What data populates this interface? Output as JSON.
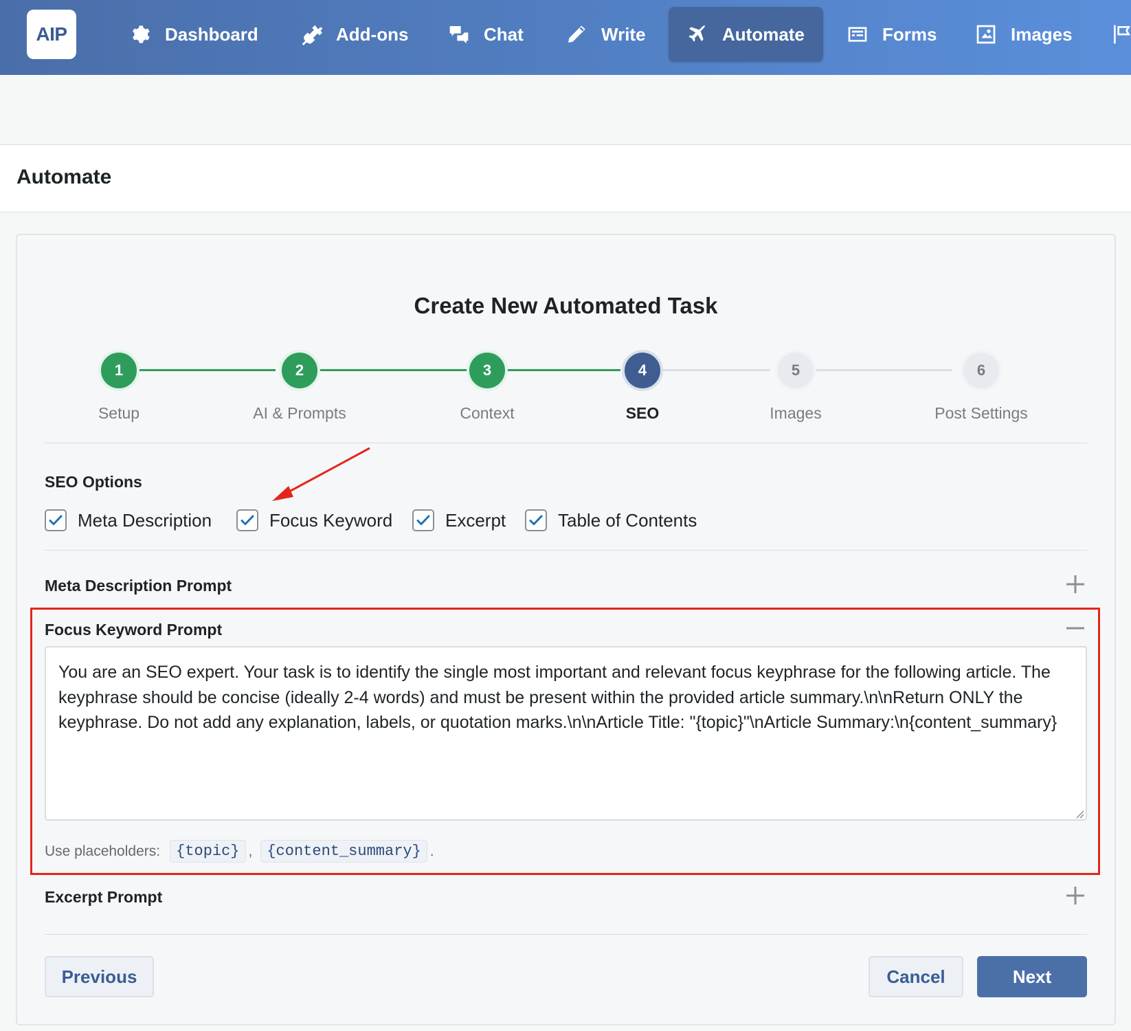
{
  "nav": {
    "logo": "AIP",
    "items": [
      {
        "label": "Dashboard"
      },
      {
        "label": "Add-ons"
      },
      {
        "label": "Chat"
      },
      {
        "label": "Write"
      },
      {
        "label": "Automate"
      },
      {
        "label": "Forms"
      },
      {
        "label": "Images"
      }
    ],
    "active_item": "Automate"
  },
  "page": {
    "title": "Automate"
  },
  "wizard": {
    "title": "Create New Automated Task",
    "current_step": 4,
    "steps": [
      {
        "number": "1",
        "label": "Setup",
        "state": "done"
      },
      {
        "number": "2",
        "label": "AI & Prompts",
        "state": "done"
      },
      {
        "number": "3",
        "label": "Context",
        "state": "done"
      },
      {
        "number": "4",
        "label": "SEO",
        "state": "current"
      },
      {
        "number": "5",
        "label": "Images",
        "state": "todo"
      },
      {
        "number": "6",
        "label": "Post Settings",
        "state": "todo"
      }
    ]
  },
  "seo": {
    "options_title": "SEO Options",
    "options": [
      {
        "label": "Meta Description",
        "checked": true
      },
      {
        "label": "Focus Keyword",
        "checked": true
      },
      {
        "label": "Excerpt",
        "checked": true
      },
      {
        "label": "Table of Contents",
        "checked": true
      }
    ],
    "accordions": {
      "meta": {
        "label": "Meta Description Prompt",
        "expanded": false
      },
      "focus": {
        "label": "Focus Keyword Prompt",
        "expanded": true,
        "value": "You are an SEO expert. Your task is to identify the single most important and relevant focus keyphrase for the following article. The keyphrase should be concise (ideally 2-4 words) and must be present within the provided article summary.\\n\\nReturn ONLY the keyphrase. Do not add any explanation, labels, or quotation marks.\\n\\nArticle Title: \"{topic}\"\\nArticle Summary:\\n{content_summary}",
        "placeholders_label": "Use placeholders:",
        "placeholders": [
          "{topic}",
          "{content_summary}"
        ],
        "separator": ",",
        "end": "."
      },
      "excerpt": {
        "label": "Excerpt Prompt",
        "expanded": false
      }
    }
  },
  "buttons": {
    "previous": "Previous",
    "cancel": "Cancel",
    "next": "Next"
  },
  "colors": {
    "nav_gradient_start": "#4a6ea9",
    "nav_gradient_end": "#5b8fdb",
    "step_done": "#2e9d5c",
    "step_current": "#3f5d91",
    "primary_button": "#4b70a8",
    "annotation_red": "#e3261b"
  }
}
